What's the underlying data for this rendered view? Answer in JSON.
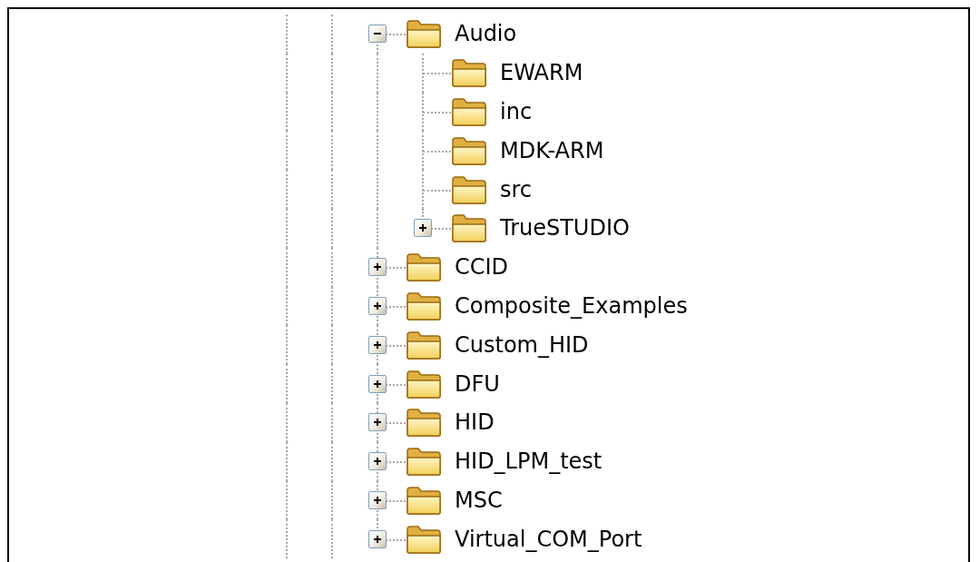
{
  "tree": {
    "items": [
      {
        "label": "Audio",
        "kind": "branch",
        "expanded": true,
        "children": [
          {
            "label": "EWARM",
            "kind": "leaf"
          },
          {
            "label": "inc",
            "kind": "leaf"
          },
          {
            "label": "MDK-ARM",
            "kind": "leaf"
          },
          {
            "label": "src",
            "kind": "leaf"
          },
          {
            "label": "TrueSTUDIO",
            "kind": "branch",
            "expanded": false
          }
        ]
      },
      {
        "label": "CCID",
        "kind": "branch",
        "expanded": false
      },
      {
        "label": "Composite_Examples",
        "kind": "branch",
        "expanded": false
      },
      {
        "label": "Custom_HID",
        "kind": "branch",
        "expanded": false
      },
      {
        "label": "DFU",
        "kind": "branch",
        "expanded": false
      },
      {
        "label": "HID",
        "kind": "branch",
        "expanded": false
      },
      {
        "label": "HID_LPM_test",
        "kind": "branch",
        "expanded": false
      },
      {
        "label": "MSC",
        "kind": "branch",
        "expanded": false
      },
      {
        "label": "Virtual_COM_Port",
        "kind": "branch",
        "expanded": false
      }
    ]
  }
}
